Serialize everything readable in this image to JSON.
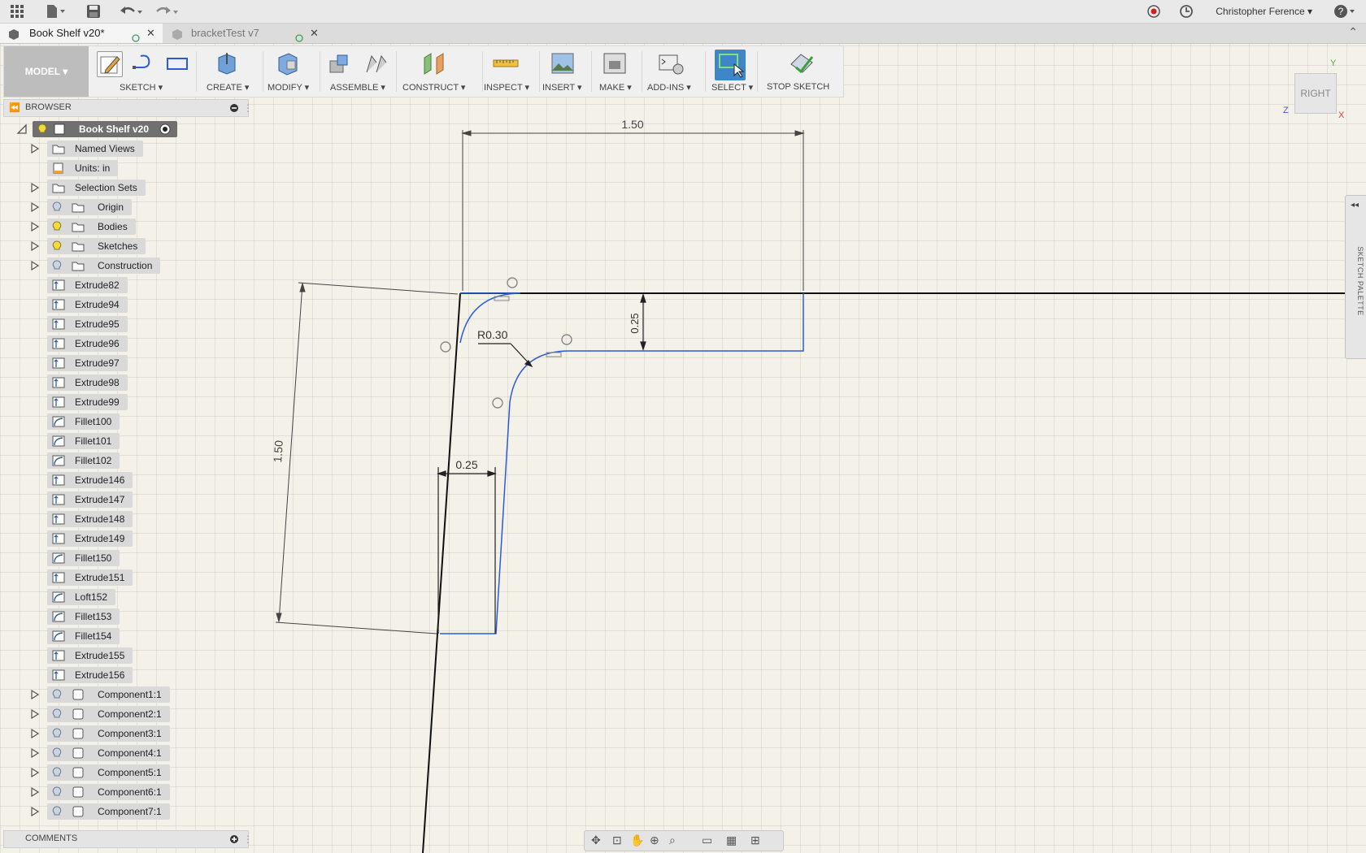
{
  "app": {
    "user_name": "Christopher Ference",
    "icons": [
      "grid-menu-icon",
      "file-icon",
      "save-icon",
      "undo-icon",
      "redo-icon",
      "record-icon",
      "clock-icon",
      "help-icon"
    ]
  },
  "tabs": [
    {
      "label": "Book Shelf v20*",
      "active": true
    },
    {
      "label": "bracketTest v7",
      "active": false
    }
  ],
  "toolbar": {
    "workspace": "MODEL",
    "groups": [
      {
        "label": "SKETCH"
      },
      {
        "label": "CREATE"
      },
      {
        "label": "MODIFY"
      },
      {
        "label": "ASSEMBLE"
      },
      {
        "label": "CONSTRUCT"
      },
      {
        "label": "INSPECT"
      },
      {
        "label": "INSERT"
      },
      {
        "label": "MAKE"
      },
      {
        "label": "ADD-INS"
      },
      {
        "label": "SELECT"
      },
      {
        "label": "STOP SKETCH"
      }
    ]
  },
  "browser": {
    "title": "BROWSER",
    "root": "Book Shelf v20",
    "items": [
      {
        "label": "Named Views",
        "kind": "folder",
        "expand": true,
        "bulb": false
      },
      {
        "label": "Units: in",
        "kind": "doc",
        "expand": false,
        "bulb": false
      },
      {
        "label": "Selection Sets",
        "kind": "folder",
        "expand": true,
        "bulb": false
      },
      {
        "label": "Origin",
        "kind": "folder",
        "expand": true,
        "bulb": "off"
      },
      {
        "label": "Bodies",
        "kind": "folder",
        "expand": true,
        "bulb": "on"
      },
      {
        "label": "Sketches",
        "kind": "folder",
        "expand": true,
        "bulb": "on"
      },
      {
        "label": "Construction",
        "kind": "folder",
        "expand": true,
        "bulb": "off"
      },
      {
        "label": "Extrude82",
        "kind": "feature"
      },
      {
        "label": "Extrude94",
        "kind": "feature"
      },
      {
        "label": "Extrude95",
        "kind": "feature"
      },
      {
        "label": "Extrude96",
        "kind": "feature"
      },
      {
        "label": "Extrude97",
        "kind": "feature"
      },
      {
        "label": "Extrude98",
        "kind": "feature"
      },
      {
        "label": "Extrude99",
        "kind": "feature"
      },
      {
        "label": "Fillet100",
        "kind": "feature"
      },
      {
        "label": "Fillet101",
        "kind": "feature"
      },
      {
        "label": "Fillet102",
        "kind": "feature"
      },
      {
        "label": "Extrude146",
        "kind": "feature"
      },
      {
        "label": "Extrude147",
        "kind": "feature"
      },
      {
        "label": "Extrude148",
        "kind": "feature"
      },
      {
        "label": "Extrude149",
        "kind": "feature"
      },
      {
        "label": "Fillet150",
        "kind": "feature"
      },
      {
        "label": "Extrude151",
        "kind": "feature"
      },
      {
        "label": "Loft152",
        "kind": "feature"
      },
      {
        "label": "Fillet153",
        "kind": "feature"
      },
      {
        "label": "Fillet154",
        "kind": "feature"
      },
      {
        "label": "Extrude155",
        "kind": "feature"
      },
      {
        "label": "Extrude156",
        "kind": "feature"
      },
      {
        "label": "Component1:1",
        "kind": "component",
        "expand": true,
        "bulb": "off"
      },
      {
        "label": "Component2:1",
        "kind": "component",
        "expand": true,
        "bulb": "off"
      },
      {
        "label": "Component3:1",
        "kind": "component",
        "expand": true,
        "bulb": "off"
      },
      {
        "label": "Component4:1",
        "kind": "component",
        "expand": true,
        "bulb": "off"
      },
      {
        "label": "Component5:1",
        "kind": "component",
        "expand": true,
        "bulb": "off"
      },
      {
        "label": "Component6:1",
        "kind": "component",
        "expand": true,
        "bulb": "off"
      },
      {
        "label": "Component7:1",
        "kind": "component",
        "expand": true,
        "bulb": "off"
      }
    ]
  },
  "comments": {
    "title": "COMMENTS"
  },
  "viewcube": {
    "face": "RIGHT",
    "axis_y": "Y",
    "axis_z": "Z",
    "axis_x": "X"
  },
  "sketch_palette": {
    "title": "SKETCH PALETTE"
  },
  "sketch": {
    "dim_top_width": "1.50",
    "dim_height": "1.50",
    "dim_thickness_top": "0.25",
    "dim_thickness_side": "0.25",
    "dim_radius": "R0.30"
  },
  "colors": {
    "sketch_line": "#2b5bd8",
    "accent_select": "#3f86c8"
  }
}
